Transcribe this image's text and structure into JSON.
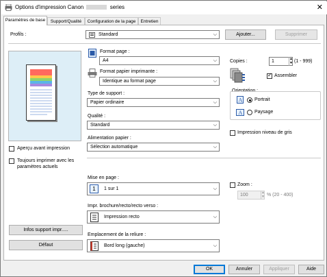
{
  "window": {
    "title_prefix": "Options d'impression Canon",
    "title_suffix": "series",
    "close_glyph": "✕"
  },
  "tabs": [
    {
      "label": "Paramètres de base"
    },
    {
      "label": "Support/Qualité"
    },
    {
      "label": "Configuration de la page"
    },
    {
      "label": "Entretien"
    }
  ],
  "profiles": {
    "label": "Profils :",
    "value": "Standard",
    "add_button": "Ajouter...",
    "delete_button": "Supprimer"
  },
  "preview": {
    "preview_checkbox": "Aperçu avant impression",
    "always_print_checkbox_line1": "Toujours imprimer avec les",
    "always_print_checkbox_line2": "paramètres actuels",
    "media_info_button": "Infos support impr.....",
    "default_button": "Défaut"
  },
  "page_format": {
    "label": "Format page :",
    "value": "A4"
  },
  "printer_paper_format": {
    "label": "Format papier imprimante :",
    "value": "Identique au format page"
  },
  "media_type": {
    "label": "Type de support :",
    "value": "Papier ordinaire"
  },
  "quality": {
    "label": "Qualité :",
    "value": "Standard"
  },
  "paper_feed": {
    "label": "Alimentation papier :",
    "value": "Sélection automatique"
  },
  "copies": {
    "label": "Copies :",
    "value": "1",
    "range": "(1 - 999)",
    "collate": "Assembler",
    "collate_checked": true
  },
  "orientation": {
    "label": "Orientation :",
    "portrait": "Portrait",
    "landscape": "Paysage",
    "selected": "portrait"
  },
  "grayscale": {
    "label": "Impression niveau de gris",
    "checked": false
  },
  "layout": {
    "label": "Mise en page :",
    "value": "1 sur 1",
    "icon_text": "1"
  },
  "zoom": {
    "label": "Zoom :",
    "value": "100",
    "range": "% (20 - 400)",
    "checked": false
  },
  "duplex": {
    "label": "Impr. brochure/recto/recto verso :",
    "value": "Impression recto"
  },
  "binding": {
    "label": "Emplacement de la reliure :",
    "value": "Bord long (gauche)"
  },
  "footer": {
    "ok": "OK",
    "cancel": "Annuler",
    "apply": "Appliquer",
    "help": "Aide"
  },
  "colors": {
    "accent": "#0078d7",
    "preview_bg": "#ddeef7"
  }
}
